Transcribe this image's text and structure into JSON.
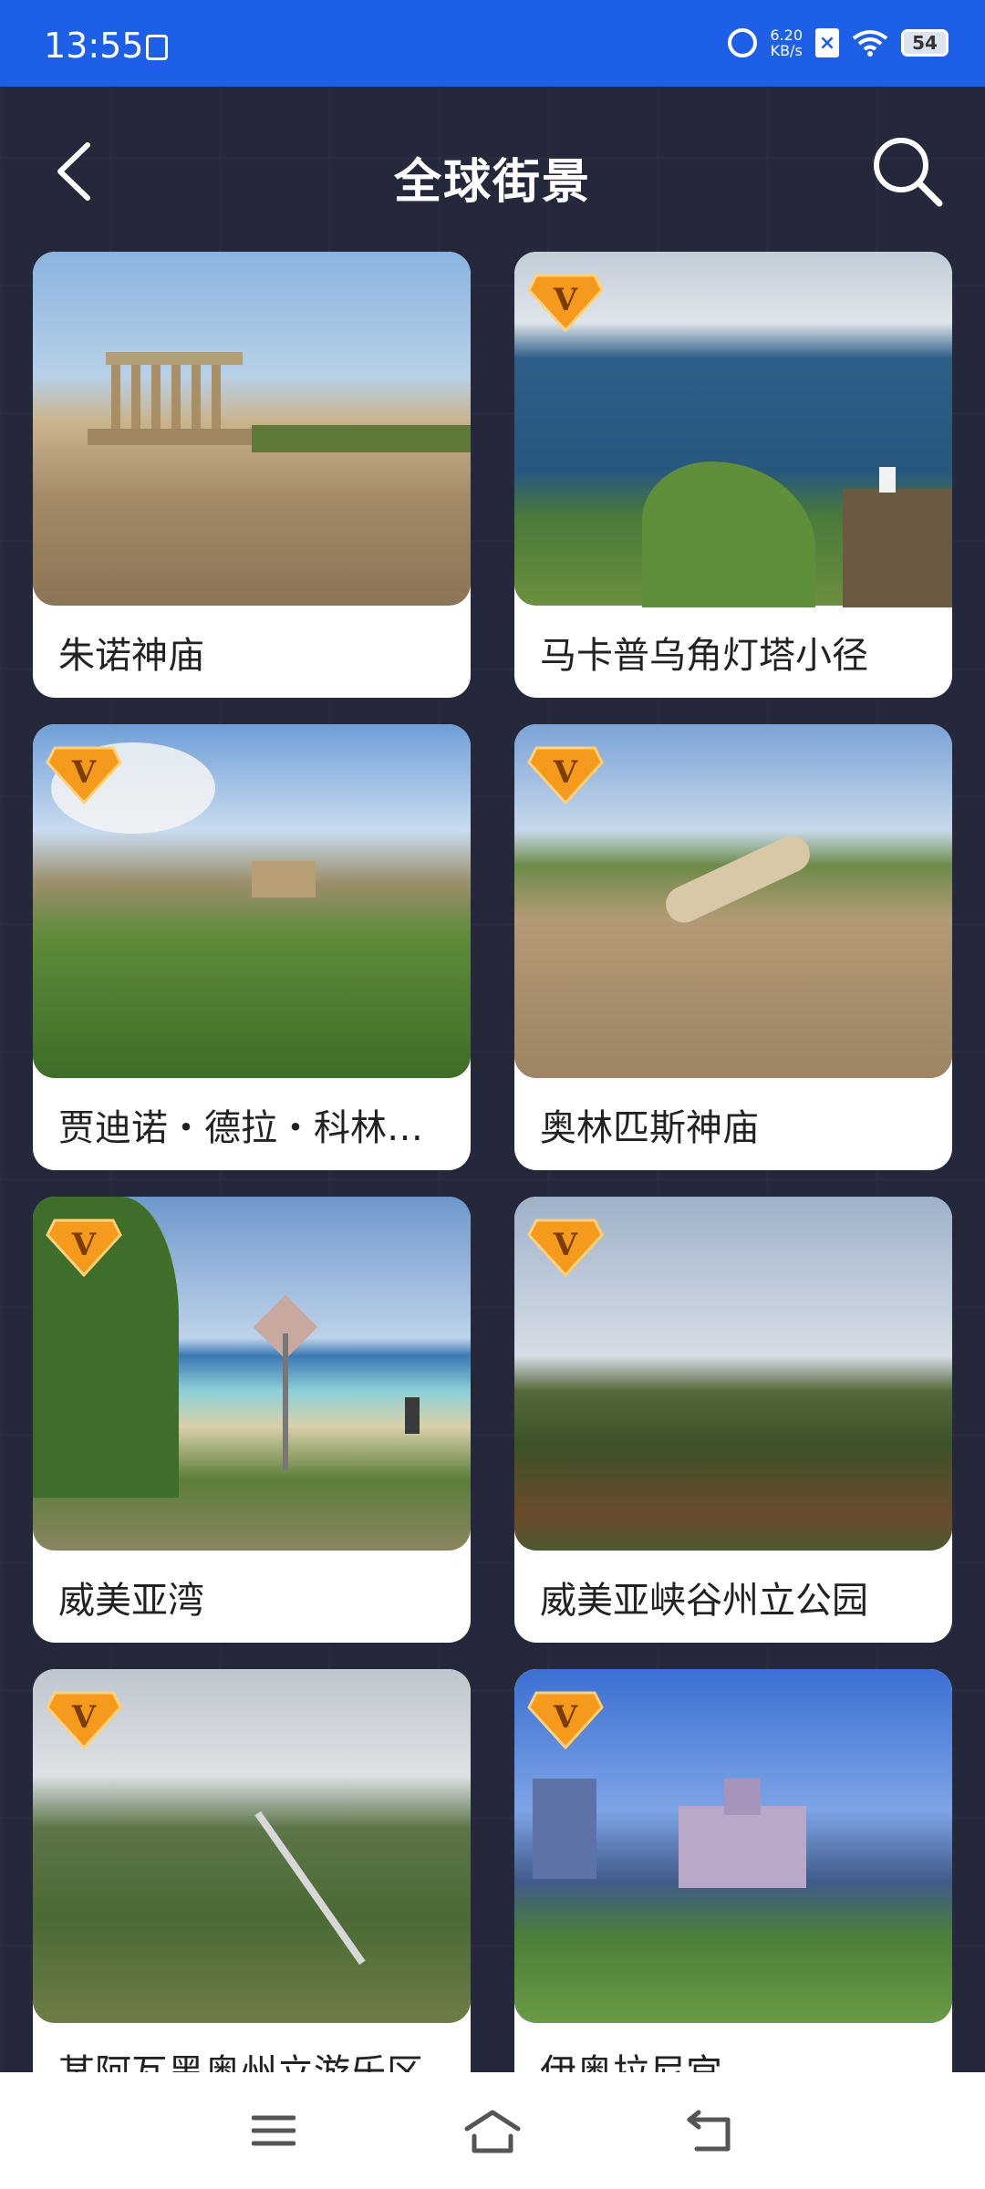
{
  "status_bar": {
    "time": "13:55",
    "net_speed_value": "6.20",
    "net_speed_unit": "KB/s",
    "battery": "54"
  },
  "header": {
    "title": "全球街景",
    "back_icon": "chevron-left-icon",
    "search_icon": "search-icon"
  },
  "cards": [
    {
      "label": "朱诺神庙",
      "vip": false
    },
    {
      "label": "马卡普乌角灯塔小径",
      "vip": true
    },
    {
      "label": "贾迪诺・德拉・科林…",
      "vip": true
    },
    {
      "label": "奥林匹斯神庙",
      "vip": true
    },
    {
      "label": "威美亚湾",
      "vip": true
    },
    {
      "label": "威美亚峡谷州立公园",
      "vip": true
    },
    {
      "label": "某阿瓦黑奥州立游乐区",
      "vip": true
    },
    {
      "label": "伊奥拉尼宫",
      "vip": true
    }
  ],
  "vip_badge_letter": "V",
  "colors": {
    "status_bar": "#1d5fe6",
    "background": "#25273a",
    "vip_orange": "#f59a1c"
  },
  "nav_bar": {
    "menu_icon": "menu-icon",
    "home_icon": "home-icon",
    "back_icon": "back-icon"
  }
}
